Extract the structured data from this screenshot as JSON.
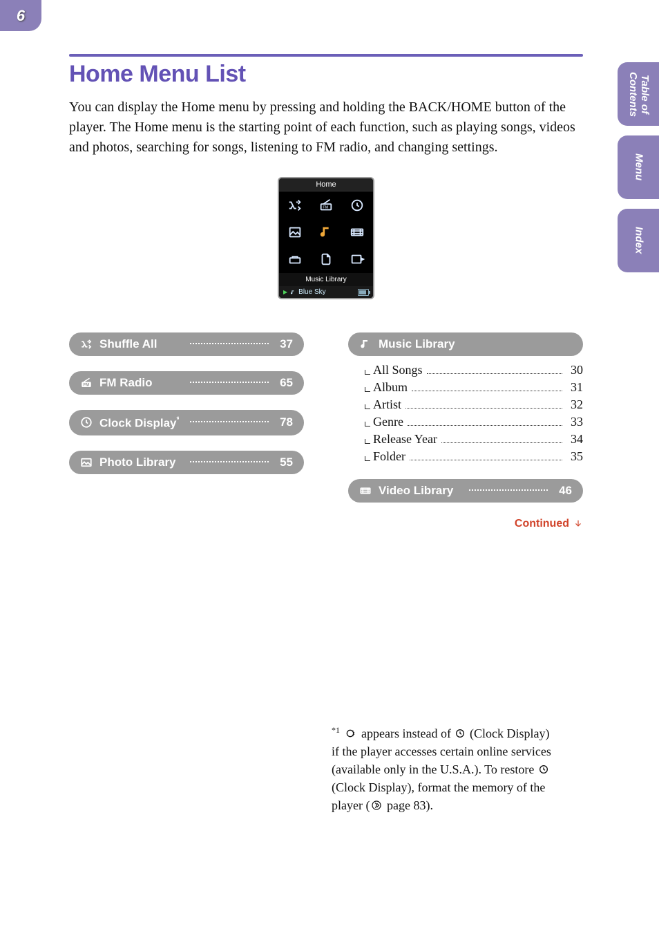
{
  "page_number": "6",
  "title": "Home Menu List",
  "intro": "You can display the Home menu by pressing and holding the BACK/HOME button of the player. The Home menu is the starting point of each function, such as playing songs, videos and photos, searching for songs, listening to FM radio, and changing settings.",
  "side_tabs": [
    "Table of\nContents",
    "Menu",
    "Index"
  ],
  "device": {
    "title": "Home",
    "label": "Music Library",
    "now_playing": "Blue Sky"
  },
  "left_items": [
    {
      "icon": "shuffle",
      "label": "Shuffle All",
      "page": "37"
    },
    {
      "icon": "fm",
      "label": "FM Radio",
      "page": "65"
    },
    {
      "icon": "clock",
      "label": "Clock Display",
      "sup": "*1",
      "page": "78"
    },
    {
      "icon": "photo",
      "label": "Photo Library",
      "page": "55"
    }
  ],
  "music_header": {
    "icon": "music",
    "label": "Music Library"
  },
  "music_children": [
    {
      "label": "All Songs",
      "page": "30"
    },
    {
      "label": "Album",
      "page": "31"
    },
    {
      "label": "Artist",
      "page": "32"
    },
    {
      "label": "Genre",
      "page": "33"
    },
    {
      "label": "Release Year",
      "page": "34"
    },
    {
      "label": "Folder",
      "page": "35"
    }
  ],
  "video_item": {
    "icon": "video",
    "label": "Video Library",
    "page": "46"
  },
  "continued": "Continued",
  "footnote": {
    "marker": "*1",
    "pre_icon_text": " appears instead of ",
    "post_icon_text_1": " (Clock Display) if the player accesses certain online services (available only in the U.S.A.). To restore ",
    "post_icon_text_2": " (Clock Display), format the memory of the player (",
    "tail": " page 83)."
  }
}
